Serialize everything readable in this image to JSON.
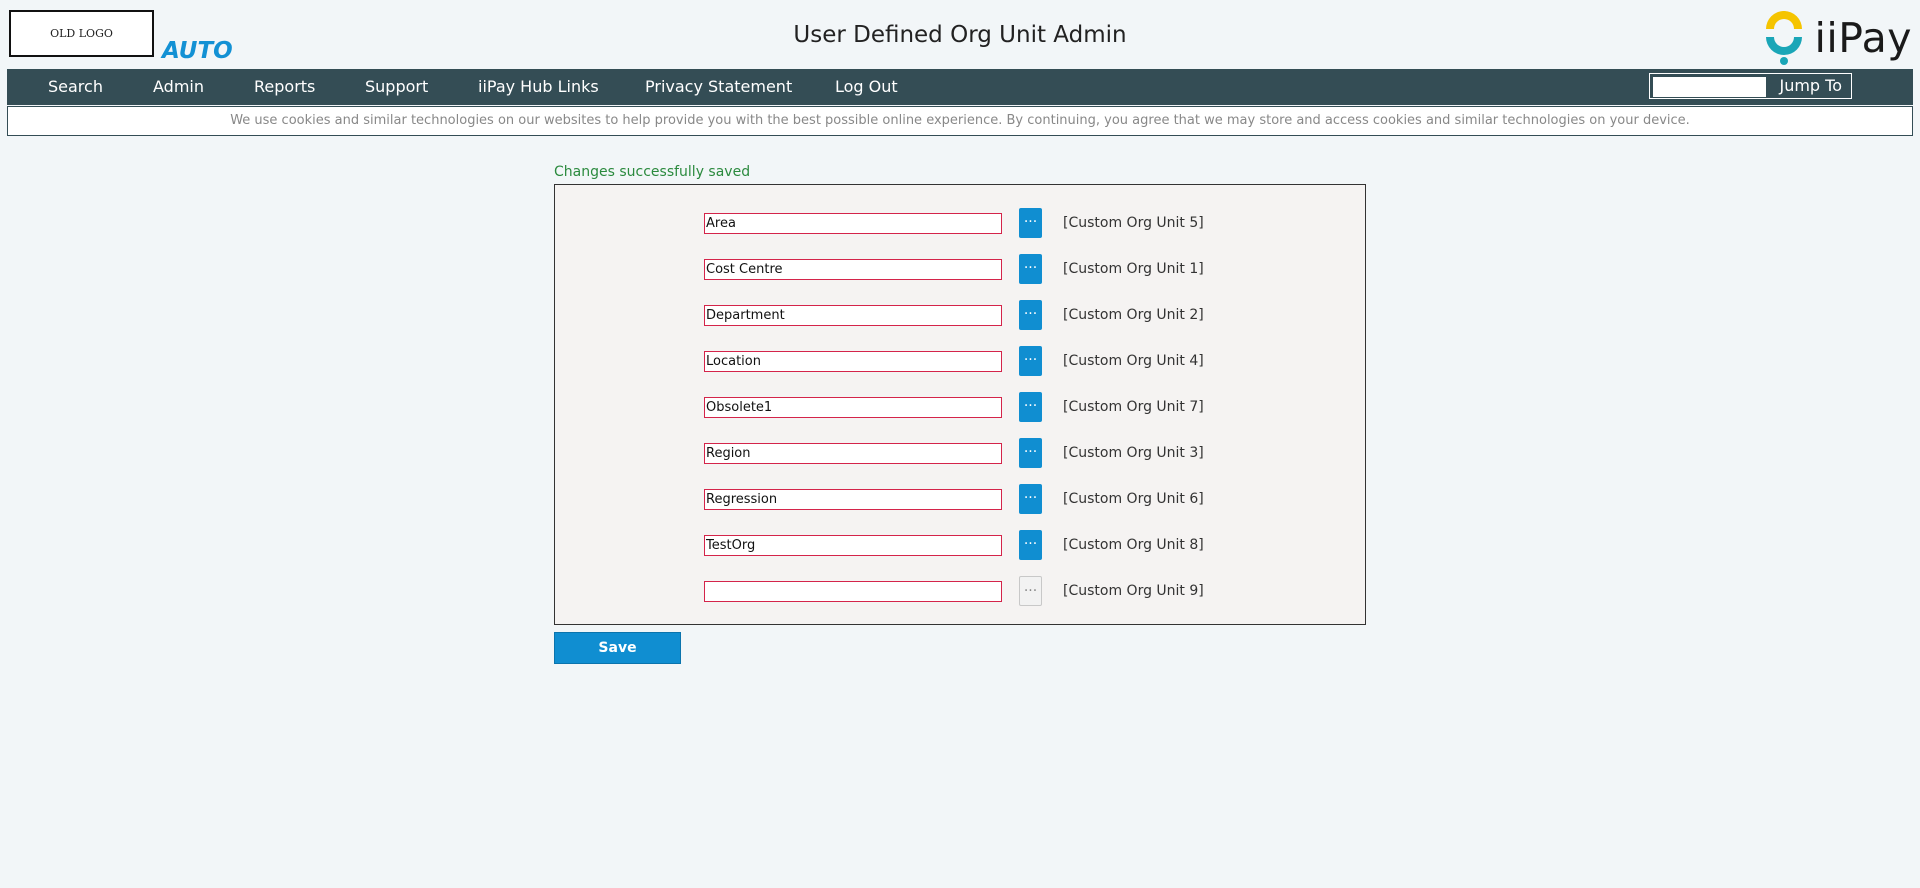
{
  "header": {
    "old_logo_text": "OLD LOGO",
    "auto_label": "AUTO",
    "title": "User Defined Org Unit Admin",
    "brand_text": "iiPay"
  },
  "nav": {
    "items": [
      "Search",
      "Admin",
      "Reports",
      "Support",
      "iiPay Hub Links",
      "Privacy Statement",
      "Log Out"
    ],
    "jump_to_label": "Jump To",
    "jump_input_value": ""
  },
  "cookie_notice": "We use cookies and similar technologies on our websites to help provide you with the best possible online experience. By continuing, you agree that we may store and access cookies and similar technologies on your device.",
  "status_message": "Changes successfully saved",
  "org_units": [
    {
      "value": "Area",
      "label": "[Custom Org Unit 5]",
      "enabled": true
    },
    {
      "value": "Cost Centre",
      "label": "[Custom Org Unit 1]",
      "enabled": true
    },
    {
      "value": "Department",
      "label": "[Custom Org Unit 2]",
      "enabled": true
    },
    {
      "value": "Location",
      "label": "[Custom Org Unit 4]",
      "enabled": true
    },
    {
      "value": "Obsolete1",
      "label": "[Custom Org Unit 7]",
      "enabled": true
    },
    {
      "value": "Region",
      "label": "[Custom Org Unit 3]",
      "enabled": true
    },
    {
      "value": "Regression",
      "label": "[Custom Org Unit 6]",
      "enabled": true
    },
    {
      "value": "TestOrg",
      "label": "[Custom Org Unit 8]",
      "enabled": true
    },
    {
      "value": "",
      "label": "[Custom Org Unit 9]",
      "enabled": false
    }
  ],
  "dots_label": "···",
  "save_label": "Save",
  "colors": {
    "nav_bg": "#344d55",
    "accent": "#108ed1",
    "input_border": "#d4244a",
    "success": "#2b8a3e",
    "logo_yellow": "#f5c400",
    "logo_teal": "#1aa6b7"
  }
}
